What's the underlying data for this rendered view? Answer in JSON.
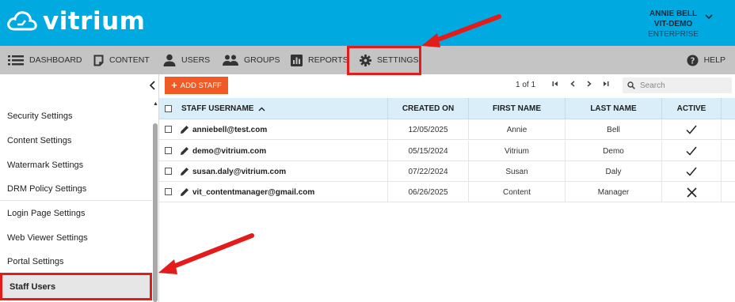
{
  "header": {
    "logo_text": "vitrium",
    "user_name": "ANNIE BELL",
    "org": "VIT-DEMO",
    "tier": "ENTERPRISE",
    "brand_color": "#00a9e0"
  },
  "nav": {
    "items": [
      {
        "label": "DASHBOARD",
        "icon": "list-icon"
      },
      {
        "label": "CONTENT",
        "icon": "document-icon"
      },
      {
        "label": "USERS",
        "icon": "user-icon"
      },
      {
        "label": "GROUPS",
        "icon": "group-icon"
      },
      {
        "label": "REPORTS",
        "icon": "bar-chart-icon"
      },
      {
        "label": "SETTINGS",
        "icon": "gear-icon"
      }
    ],
    "help_label": "HELP",
    "highlighted": "SETTINGS"
  },
  "sidebar": {
    "items": [
      {
        "label": "Security Settings"
      },
      {
        "label": "Content Settings"
      },
      {
        "label": "Watermark Settings"
      },
      {
        "label": "DRM Policy Settings"
      },
      {
        "label": "Login Page Settings"
      },
      {
        "label": "Web Viewer Settings"
      },
      {
        "label": "Portal Settings"
      },
      {
        "label": "Staff Users"
      }
    ],
    "active": "Staff Users"
  },
  "toolbar": {
    "add_label": "ADD STAFF",
    "pager_text": "1 of 1",
    "search_placeholder": "Search",
    "accent_color": "#f15a24"
  },
  "table": {
    "columns": [
      "STAFF USERNAME",
      "CREATED ON",
      "FIRST NAME",
      "LAST NAME",
      "ACTIVE"
    ],
    "sort_column": "STAFF USERNAME",
    "sort_direction": "ascending",
    "rows": [
      {
        "username": "anniebell@test.com",
        "created": "12/05/2025",
        "first": "Annie",
        "last": "Bell",
        "active": true
      },
      {
        "username": "demo@vitrium.com",
        "created": "05/15/2024",
        "first": "Vitrium",
        "last": "Demo",
        "active": true
      },
      {
        "username": "susan.daly@vitrium.com",
        "created": "07/22/2024",
        "first": "Susan",
        "last": "Daly",
        "active": true
      },
      {
        "username": "vit_contentmanager@gmail.com",
        "created": "06/26/2025",
        "first": "Content",
        "last": "Manager",
        "active": false
      }
    ]
  },
  "annotation_color": "#e31b1b"
}
